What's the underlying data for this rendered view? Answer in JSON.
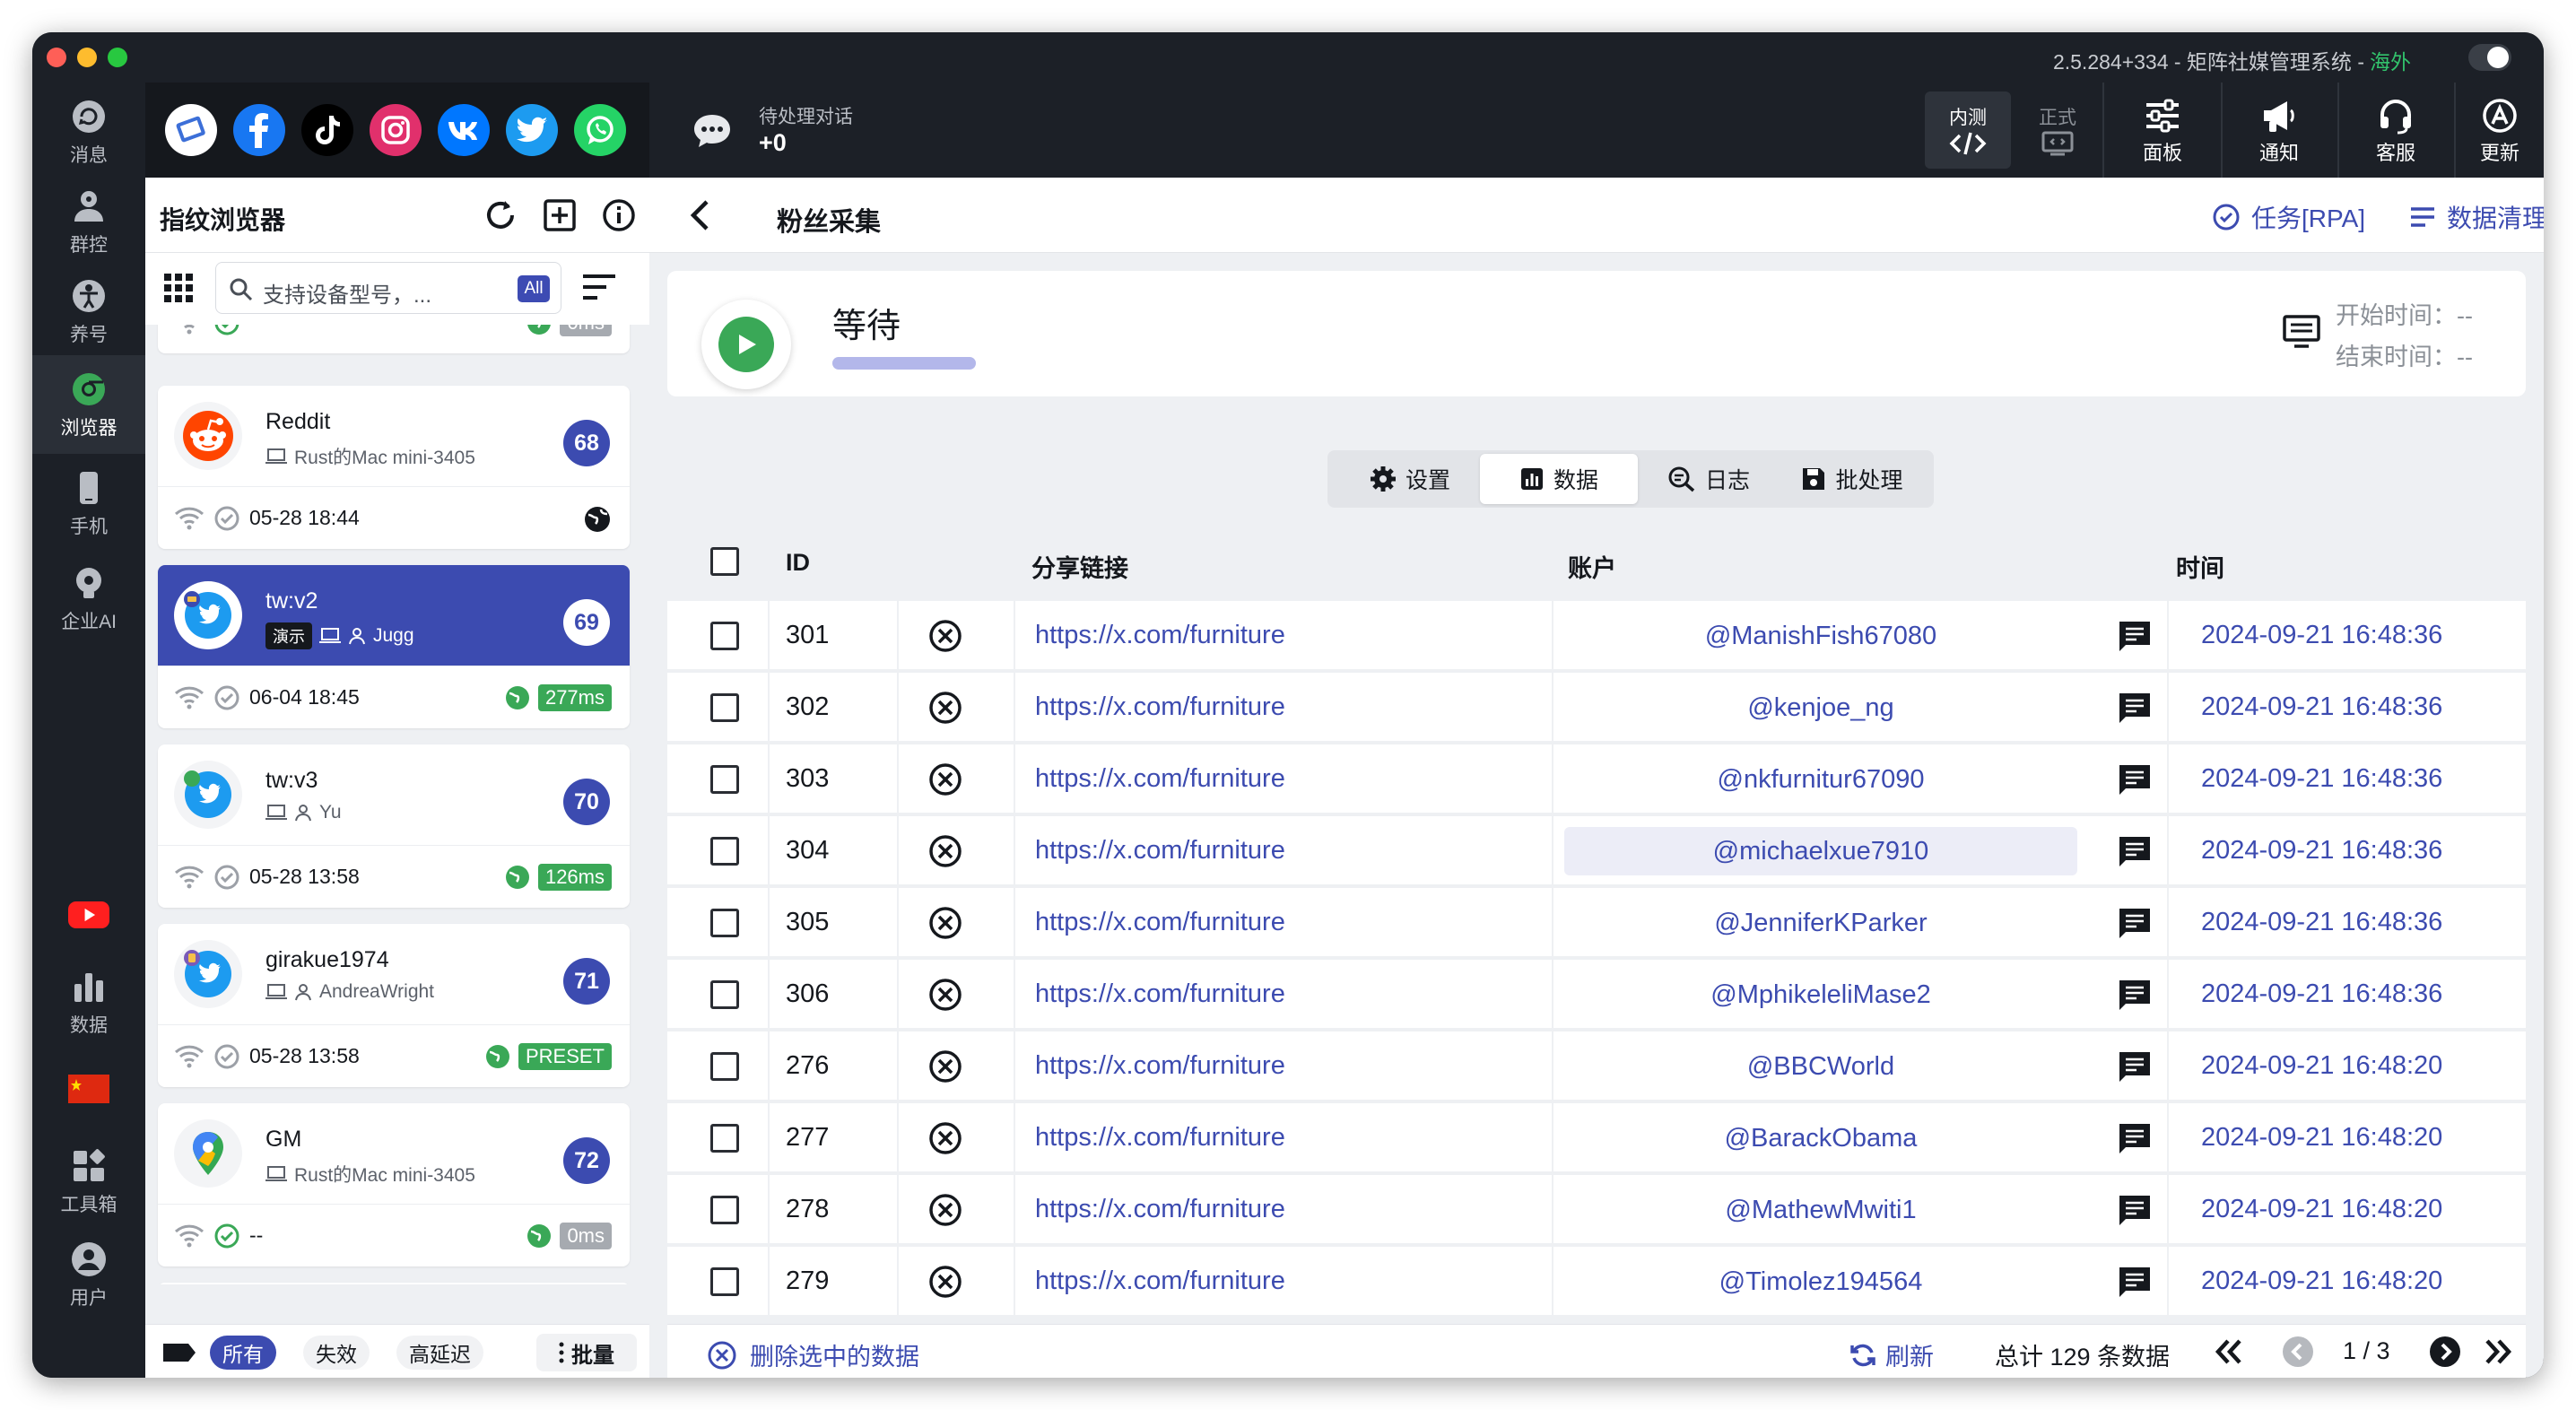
{
  "window": {
    "title": "2.5.284+334 - 矩阵社媒管理系统 -",
    "region": "海外"
  },
  "leftnav": {
    "items": [
      {
        "label": "消息",
        "icon": "message-icon"
      },
      {
        "label": "群控",
        "icon": "group-control-icon"
      },
      {
        "label": "养号",
        "icon": "account-nurture-icon"
      },
      {
        "label": "浏览器",
        "icon": "chrome-icon",
        "active": true
      },
      {
        "label": "手机",
        "icon": "phone-icon"
      },
      {
        "label": "企业AI",
        "icon": "ai-icon"
      },
      {
        "label": "数据",
        "icon": "data-chart-icon"
      },
      {
        "label": "工具箱",
        "icon": "toolbox-icon"
      },
      {
        "label": "用户",
        "icon": "user-icon"
      }
    ],
    "youtube_icon": "youtube-icon",
    "flag_icon": "china-flag-icon"
  },
  "social": [
    "web-browser-icon",
    "facebook-icon",
    "tiktok-icon",
    "instagram-icon",
    "vk-icon",
    "twitter-icon",
    "whatsapp-icon"
  ],
  "topbar": {
    "pending_label": "待处理对话",
    "pending_value": "+0",
    "env_test": "内测",
    "env_prod": "正式",
    "panel": "面板",
    "notify": "通知",
    "support": "客服",
    "update": "更新"
  },
  "device_panel": {
    "title": "指纹浏览器",
    "search_placeholder": "支持设备型号，...",
    "all_badge": "All",
    "partial_top": {
      "time": "--",
      "latency": "0ms"
    },
    "cards": [
      {
        "name": "Reddit",
        "sub": "Rust的Mac mini-3405",
        "num": "68",
        "time": "05-28 18:44",
        "latency": "",
        "icon": "reddit-icon"
      },
      {
        "name": "tw:v2",
        "tag": "演示",
        "sub": "Jugg",
        "num": "69",
        "time": "06-04 18:45",
        "latency": "277ms",
        "icon": "twitter-icon",
        "selected": true
      },
      {
        "name": "tw:v3",
        "sub": "Yu",
        "num": "70",
        "time": "05-28 13:58",
        "latency": "126ms",
        "icon": "twitter-icon"
      },
      {
        "name": "girakue1974",
        "sub": "AndreaWright",
        "num": "71",
        "time": "05-28 13:58",
        "latency": "PRESET",
        "icon": "twitter-icon"
      },
      {
        "name": "GM",
        "sub": "Rust的Mac mini-3405",
        "num": "72",
        "time": "--",
        "latency": "0ms",
        "icon": "google-maps-icon"
      }
    ],
    "filters": [
      "所有",
      "失效",
      "高延迟"
    ],
    "batch": "批量"
  },
  "main": {
    "title": "粉丝采集",
    "task_link": "任务[RPA]",
    "clean_link": "数据清理",
    "status": "等待",
    "start_time": "开始时间：--",
    "end_time": "结束时间：--",
    "tabs": [
      "设置",
      "数据",
      "日志",
      "批处理"
    ],
    "active_tab": "数据",
    "columns": {
      "id": "ID",
      "link": "分享链接",
      "account": "账户",
      "time": "时间"
    },
    "rows": [
      {
        "id": "301",
        "link": "https://x.com/furniture",
        "account": "@ManishFish67080",
        "time": "2024-09-21 16:48:36"
      },
      {
        "id": "302",
        "link": "https://x.com/furniture",
        "account": "@kenjoe_ng",
        "time": "2024-09-21 16:48:36"
      },
      {
        "id": "303",
        "link": "https://x.com/furniture",
        "account": "@nkfurnitur67090",
        "time": "2024-09-21 16:48:36"
      },
      {
        "id": "304",
        "link": "https://x.com/furniture",
        "account": "@michaelxue7910",
        "time": "2024-09-21 16:48:36",
        "highlight": true
      },
      {
        "id": "305",
        "link": "https://x.com/furniture",
        "account": "@JenniferKParker",
        "time": "2024-09-21 16:48:36"
      },
      {
        "id": "306",
        "link": "https://x.com/furniture",
        "account": "@MphikeleliMase2",
        "time": "2024-09-21 16:48:36"
      },
      {
        "id": "276",
        "link": "https://x.com/furniture",
        "account": "@BBCWorld",
        "time": "2024-09-21 16:48:20"
      },
      {
        "id": "277",
        "link": "https://x.com/furniture",
        "account": "@BarackObama",
        "time": "2024-09-21 16:48:20"
      },
      {
        "id": "278",
        "link": "https://x.com/furniture",
        "account": "@MathewMwiti1",
        "time": "2024-09-21 16:48:20"
      },
      {
        "id": "279",
        "link": "https://x.com/furniture",
        "account": "@Timolez194564",
        "time": "2024-09-21 16:48:20"
      }
    ],
    "footer": {
      "delete_selected": "删除选中的数据",
      "refresh": "刷新",
      "total": "总计 129 条数据",
      "page": "1 / 3"
    }
  },
  "colors": {
    "accent": "#3c4bb0",
    "success": "#3aa857",
    "sidebar": "#1c2027"
  }
}
